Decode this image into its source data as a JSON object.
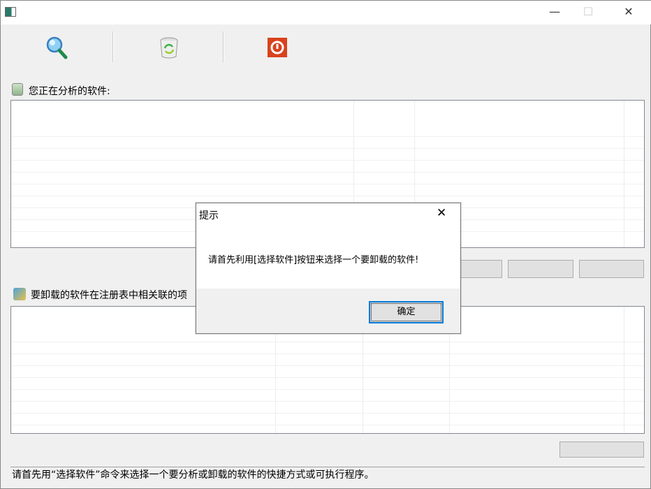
{
  "window": {
    "minimize": "—",
    "maximize": "☐",
    "close": "✕"
  },
  "toolbar": [
    {
      "name": "select-software",
      "icon": "magnifier-icon"
    },
    {
      "name": "uninstall",
      "icon": "recycle-bin-icon"
    },
    {
      "name": "exit",
      "icon": "power-icon"
    }
  ],
  "top_section": {
    "label": "您正在分析的软件:"
  },
  "bottom_section": {
    "label": "要卸载的软件在注册表中相关联的项"
  },
  "status_text": "请首先用“选择软件”命令来选择一个要分析或卸载的软件的快捷方式或可执行程序。",
  "dialog": {
    "title": "提示",
    "message": "请首先利用[选择软件]按钮来选择一个要卸载的软件!",
    "ok_label": "确定",
    "close": "✕"
  }
}
